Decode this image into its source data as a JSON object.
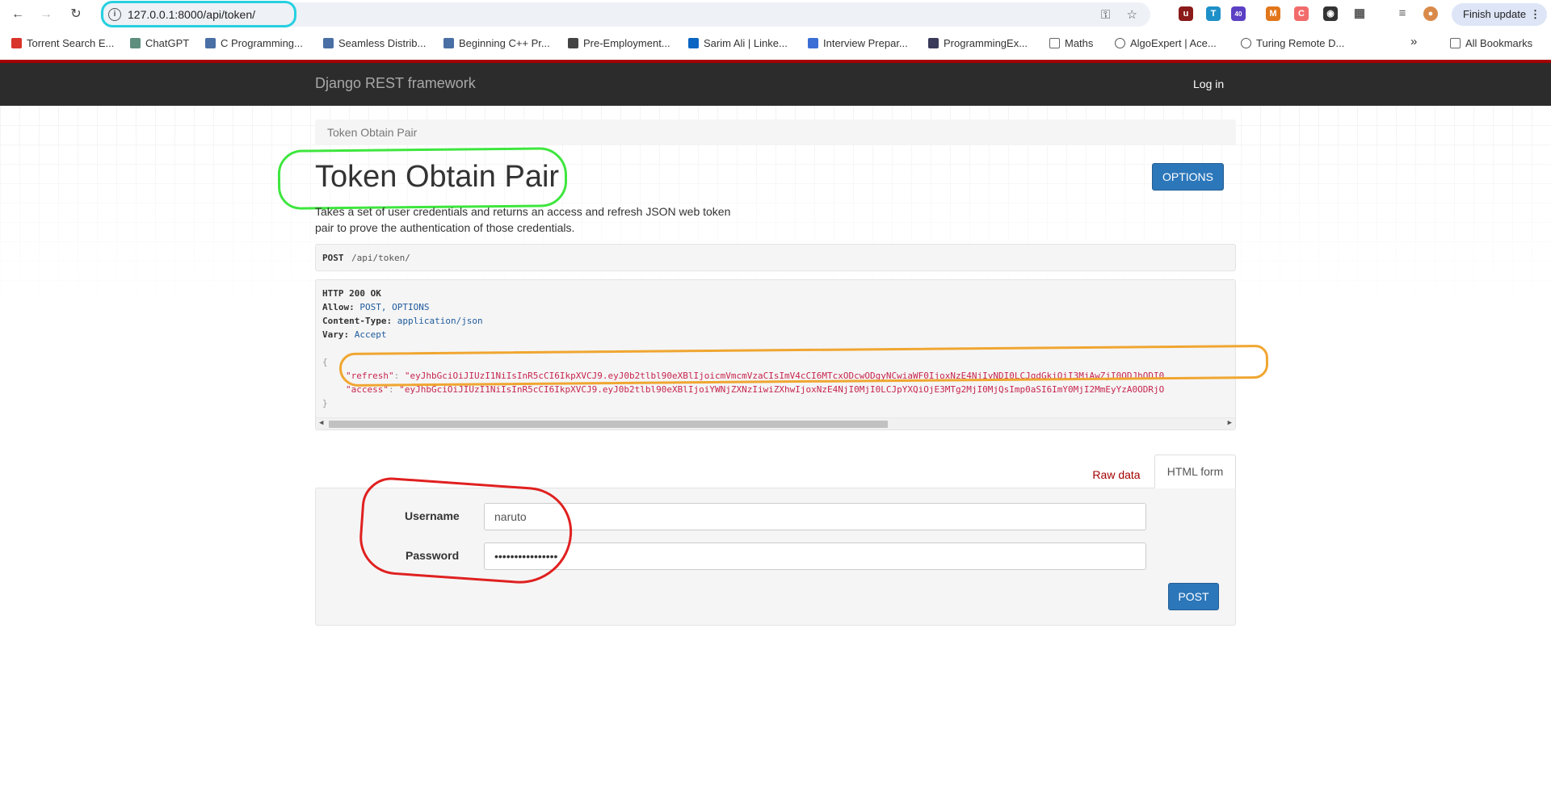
{
  "browser": {
    "url": "127.0.0.1:8000/api/token/",
    "finish_update": "Finish update",
    "extension_badge": "40",
    "bookmarks": [
      {
        "label": "Torrent Search E...",
        "color": "#d9342b"
      },
      {
        "label": "ChatGPT",
        "color": "#5e8e7e"
      },
      {
        "label": "C Programming...",
        "color": "#4a6fa5"
      },
      {
        "label": "Seamless Distrib...",
        "color": "#4a6fa5"
      },
      {
        "label": "Beginning C++ Pr...",
        "color": "#4a6fa5"
      },
      {
        "label": "Pre-Employment...",
        "color": "#444444"
      },
      {
        "label": "Sarim Ali | Linke...",
        "color": "#0a66c2"
      },
      {
        "label": "Interview Prepar...",
        "color": "#3b6fd6"
      },
      {
        "label": "ProgrammingEx...",
        "color": "#3a3a5a"
      },
      {
        "label": "Maths",
        "color": "#666666"
      },
      {
        "label": "AlgoExpert | Ace...",
        "color": "#555555"
      },
      {
        "label": "Turing Remote D...",
        "color": "#555555"
      }
    ],
    "all_bookmarks": "All Bookmarks"
  },
  "navbar": {
    "brand": "Django REST framework",
    "login": "Log in"
  },
  "breadcrumb": "Token Obtain Pair",
  "page": {
    "title": "Token Obtain Pair",
    "options_label": "OPTIONS",
    "description": "Takes a set of user credentials and returns an access and refresh JSON web token pair to prove the authentication of those credentials."
  },
  "request": {
    "method": "POST",
    "path": "/api/token/"
  },
  "response": {
    "status": "HTTP 200 OK",
    "headers": [
      {
        "key": "Allow:",
        "value": "POST, OPTIONS"
      },
      {
        "key": "Content-Type:",
        "value": "application/json"
      },
      {
        "key": "Vary:",
        "value": "Accept"
      }
    ],
    "open_brace": "{",
    "close_brace": "}",
    "refresh_key": "\"refresh\"",
    "refresh_value": "\"eyJhbGciOiJIUzI1NiIsInR5cCI6IkpXVCJ9.eyJ0b2tlbl90eXBlIjoicmVmcmVzaCIsImV4cCI6MTcxODcwODgyNCwiaWF0IjoxNzE4NjIyNDI0LCJqdGkiOiI3MjAwZjI0ODJhODI0",
    "access_key": "\"access\"",
    "access_value": "\"eyJhbGciOiJIUzI1NiIsInR5cCI6IkpXVCJ9.eyJ0b2tlbl90eXBlIjoiYWNjZXNzIiwiZXhwIjoxNzE4NjI0MjI0LCJpYXQiOjE3MTg2MjI0MjQsImp0aSI6ImY0MjI2MmEyYzA0ODRjO"
  },
  "tabs": {
    "raw": "Raw data",
    "html": "HTML form"
  },
  "form": {
    "username_label": "Username",
    "username_value": "naruto",
    "password_label": "Password",
    "password_value": "••••••••••••••••",
    "post_label": "POST"
  },
  "annotation_colors": {
    "url": "#26d0e0",
    "title": "#3ee63e",
    "refresh": "#f0a631",
    "form": "#e02020"
  }
}
